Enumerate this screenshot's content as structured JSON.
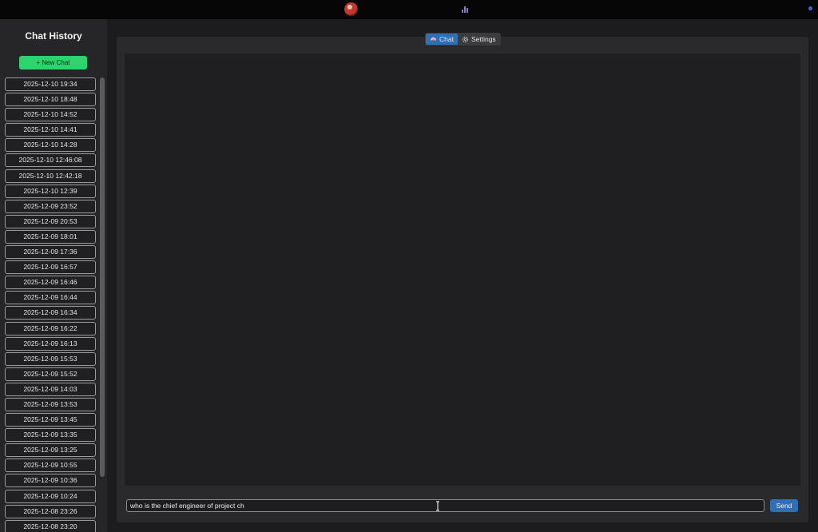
{
  "sidebar": {
    "title": "Chat History",
    "new_chat_label": "+ New Chat",
    "items": [
      "2025-12-10 19:34",
      "2025-12-10 18:48",
      "2025-12-10 14:52",
      "2025-12-10 14:41",
      "2025-12-10 14:28",
      "2025-12-10 12:46:08",
      "2025-12-10 12:42:18",
      "2025-12-10 12:39",
      "2025-12-09 23:52",
      "2025-12-09 20:53",
      "2025-12-09 18:01",
      "2025-12-09 17:36",
      "2025-12-09 16:57",
      "2025-12-09 16:46",
      "2025-12-09 16:44",
      "2025-12-09 16:34",
      "2025-12-09 16:22",
      "2025-12-09 16:13",
      "2025-12-09 15:53",
      "2025-12-09 15:52",
      "2025-12-09 14:03",
      "2025-12-09 13:53",
      "2025-12-09 13:45",
      "2025-12-09 13:35",
      "2025-12-09 13:25",
      "2025-12-09 10:55",
      "2025-12-09 10:36",
      "2025-12-09 10:24",
      "2025-12-08 23:26",
      "2025-12-08 23:20"
    ]
  },
  "tabs": [
    {
      "label": "Chat",
      "icon": "chat-icon",
      "active": true
    },
    {
      "label": "Settings",
      "icon": "gear-icon",
      "active": false
    }
  ],
  "input": {
    "value": "who is the chief engineer of project ch"
  },
  "send_label": "Send",
  "colors": {
    "accent": "#2f6fb3",
    "new_chat": "#2fd36e"
  }
}
